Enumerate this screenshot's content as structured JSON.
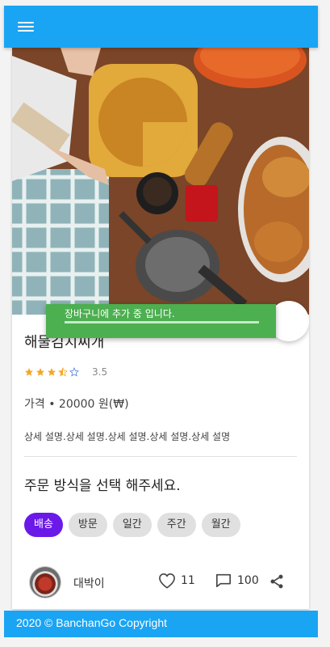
{
  "appbar": {
    "menu_icon": "menu-icon"
  },
  "product": {
    "name": "해물김치찌개",
    "rating_value": "3.5",
    "rating": 3.5,
    "price": "가격 • 20000 원(₩)",
    "description": "상세 설명.상세 설명.상세 설명.상세 설명.상세 설명"
  },
  "order": {
    "prompt": "주문 방식을 선택 해주세요.",
    "options": [
      "배송",
      "방문",
      "일간",
      "주간",
      "월간"
    ],
    "selected": "배송"
  },
  "author": {
    "name": "대박이"
  },
  "stats": {
    "likes": "11",
    "comments": "100"
  },
  "snackbar": {
    "message": "장바구니에 추가 중 입니다."
  },
  "footer": {
    "text": "2020 © BanchanGo Copyright"
  },
  "colors": {
    "primary": "#1aa4f4",
    "chip_active": "#6b19e8",
    "snackbar": "#4caf50",
    "star": "#f5a623"
  }
}
